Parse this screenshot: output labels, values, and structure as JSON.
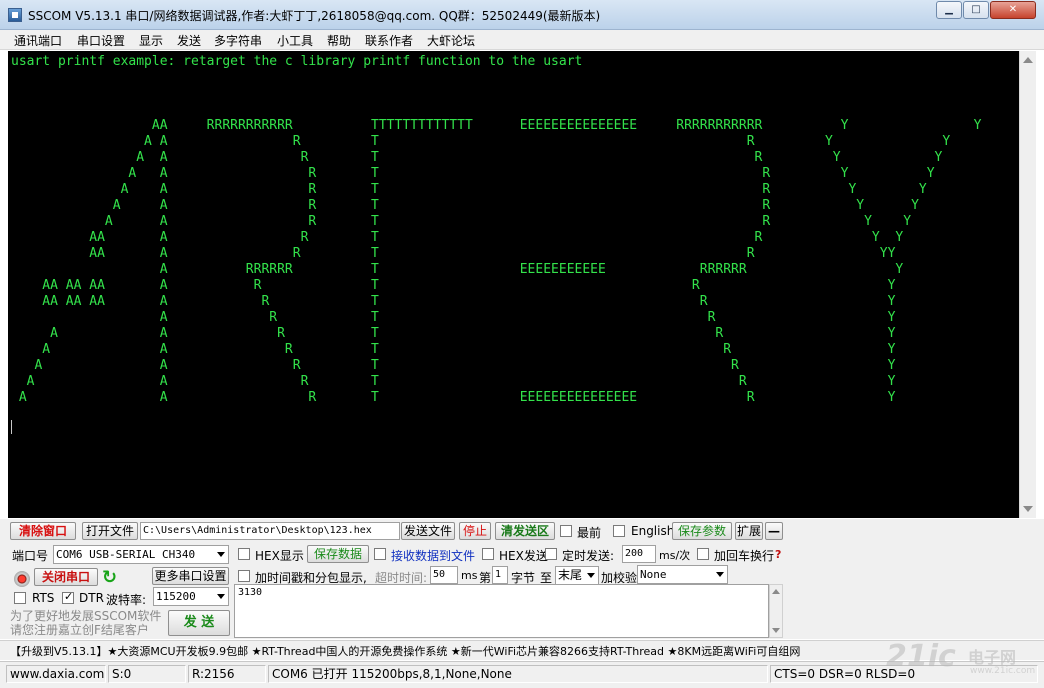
{
  "window": {
    "title": "SSCOM V5.13.1 串口/网络数据调试器,作者:大虾丁丁,2618058@qq.com. QQ群：52502449(最新版本)",
    "controls": {
      "minimize": "▁",
      "maximize": "□",
      "close": "✕"
    }
  },
  "menu": {
    "items": [
      "通讯端口",
      "串口设置",
      "显示",
      "发送",
      "多字符串",
      "小工具",
      "帮助",
      "联系作者",
      "大虾论坛"
    ]
  },
  "terminal": {
    "lines": [
      "usart printf example: retarget the c library printf function to the usart",
      "",
      "",
      "",
      "                  AA     RRRRRRRRRRR          TTTTTTTTTTTTT      EEEEEEEEEEEEEEE     RRRRRRRRRRR          Y                Y",
      "                 A A                R         T                                               R         Y              Y",
      "                A  A                 R        T                                                R         Y            Y",
      "               A   A                  R       T                                                 R         Y          Y",
      "              A    A                  R       T                                                 R          Y        Y",
      "             A     A                  R       T                                                 R           Y      Y",
      "            A      A                  R       T                                                 R            Y    Y",
      "          AA       A                 R        T                                                R              Y  Y",
      "          AA       A                R         T                                               R                YY",
      "                   A          RRRRRR          T                  EEEEEEEEEEE            RRRRRR                   Y",
      "    AA AA AA       A           R              T                                        R                        Y",
      "    AA AA AA       A            R             T                                         R                       Y",
      "                   A             R            T                                          R                      Y",
      "     A             A              R           T                                           R                     Y",
      "    A              A               R          T                                            R                    Y",
      "   A               A                R         T                                             R                   Y",
      "  A                A                 R        T                                              R                  Y",
      " A                 A                  R       T                  EEEEEEEEEEEEEEE              R                 Y"
    ]
  },
  "toolbar_row1": {
    "clear_window": "清除窗口",
    "open_file": "打开文件",
    "file_path": "C:\\Users\\Administrator\\Desktop\\123.hex",
    "send_file": "发送文件",
    "stop": "停止",
    "clear_send": "清发送区",
    "topmost": "最前",
    "english": "English",
    "save_params": "保存参数",
    "expand": "扩展",
    "collapse": "—"
  },
  "port": {
    "label": "端口号",
    "value": "COM6 USB-SERIAL CH340",
    "hex_display": "HEX显示",
    "save_data": "保存数据",
    "receive_to_file": "接收数据到文件",
    "hex_send": "HEX发送",
    "timed_send": "定时发送:",
    "interval": "200",
    "interval_unit": "ms/次",
    "add_crlf": "加回车换行",
    "help": "?"
  },
  "connection": {
    "close_port": "关闭串口",
    "more_settings": "更多串口设置",
    "timestamp": "加时间戳和分包显示,",
    "timeout_label": "超时时间:",
    "timeout_value": "50",
    "timeout_unit": "ms",
    "byte_prefix": "第",
    "byte_value": "1",
    "byte_unit": "字节",
    "to_label": "至",
    "end_value": "末尾",
    "checksum_label": "加校验",
    "checksum_value": "None"
  },
  "line_signals": {
    "rts": "RTS",
    "dtr": "DTR",
    "baud_label": "波特率:",
    "baud_value": "115200",
    "send": "发 送"
  },
  "send_input": {
    "value": "3130"
  },
  "promo": {
    "line1": "为了更好地发展SSCOM软件",
    "line2": "请您注册嘉立创F结尾客户"
  },
  "ad": {
    "text": "【升级到V5.13.1】★大资源MCU开发板9.9包邮 ★RT-Thread中国人的开源免费操作系统 ★新一代WiFi芯片兼容8266支持RT-Thread ★8KM远距离WiFi可自组网"
  },
  "status": {
    "website": "www.daxia.com",
    "sent": "S:0",
    "received": "R:2156",
    "port_status": "COM6 已打开  115200bps,8,1,None,None",
    "signals": "CTS=0 DSR=0 RLSD=0"
  },
  "watermark": {
    "main": "21ic",
    "sub": "电子网",
    "url": "www.21ic.com"
  },
  "colors": {
    "terminal_bg": "#000000",
    "terminal_text": "#33e24b",
    "alert_red": "#d81010",
    "action_green": "#1a8a1a",
    "link_blue": "#1030c0"
  }
}
